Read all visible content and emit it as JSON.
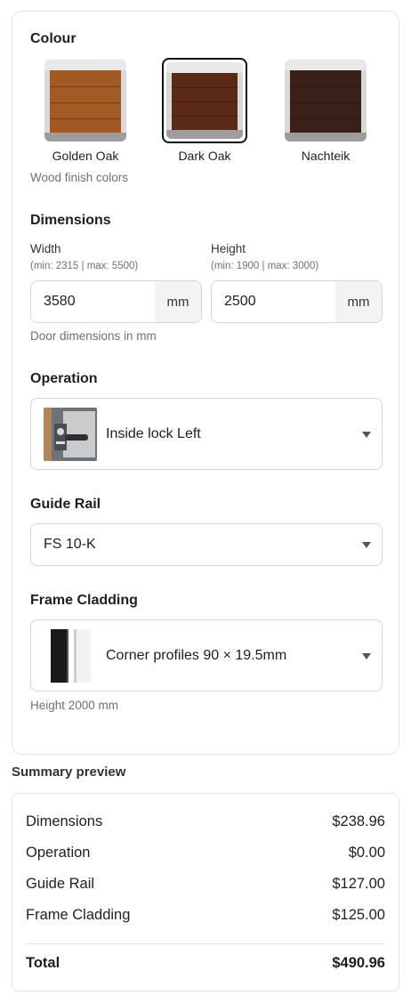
{
  "colour": {
    "title": "Colour",
    "options": [
      {
        "label": "Golden Oak",
        "color": "#a25a25",
        "selected": false
      },
      {
        "label": "Dark Oak",
        "color": "#5a2a17",
        "selected": true
      },
      {
        "label": "Nachteik",
        "color": "#3a2018",
        "selected": false
      }
    ],
    "hint": "Wood finish colors"
  },
  "dimensions": {
    "title": "Dimensions",
    "width": {
      "label": "Width",
      "range": "(min: 2315 | max: 5500)",
      "value": "3580",
      "unit": "mm"
    },
    "height": {
      "label": "Height",
      "range": "(min: 1900 | max: 3000)",
      "value": "2500",
      "unit": "mm"
    },
    "hint": "Door dimensions in mm"
  },
  "operation": {
    "title": "Operation",
    "selected": "Inside lock Left",
    "icon": "lock-photo-icon"
  },
  "guide_rail": {
    "title": "Guide Rail",
    "selected": "FS 10-K"
  },
  "frame_cladding": {
    "title": "Frame Cladding",
    "selected": "Corner profiles 90 × 19.5mm",
    "icon": "corner-profile-icon",
    "hint": "Height 2000 mm"
  },
  "summary": {
    "heading": "Summary preview",
    "rows": [
      {
        "label": "Dimensions",
        "value": "$238.96"
      },
      {
        "label": "Operation",
        "value": "$0.00"
      },
      {
        "label": "Guide Rail",
        "value": "$127.00"
      },
      {
        "label": "Frame Cladding",
        "value": "$125.00"
      }
    ],
    "total": {
      "label": "Total",
      "value": "$490.96"
    }
  }
}
